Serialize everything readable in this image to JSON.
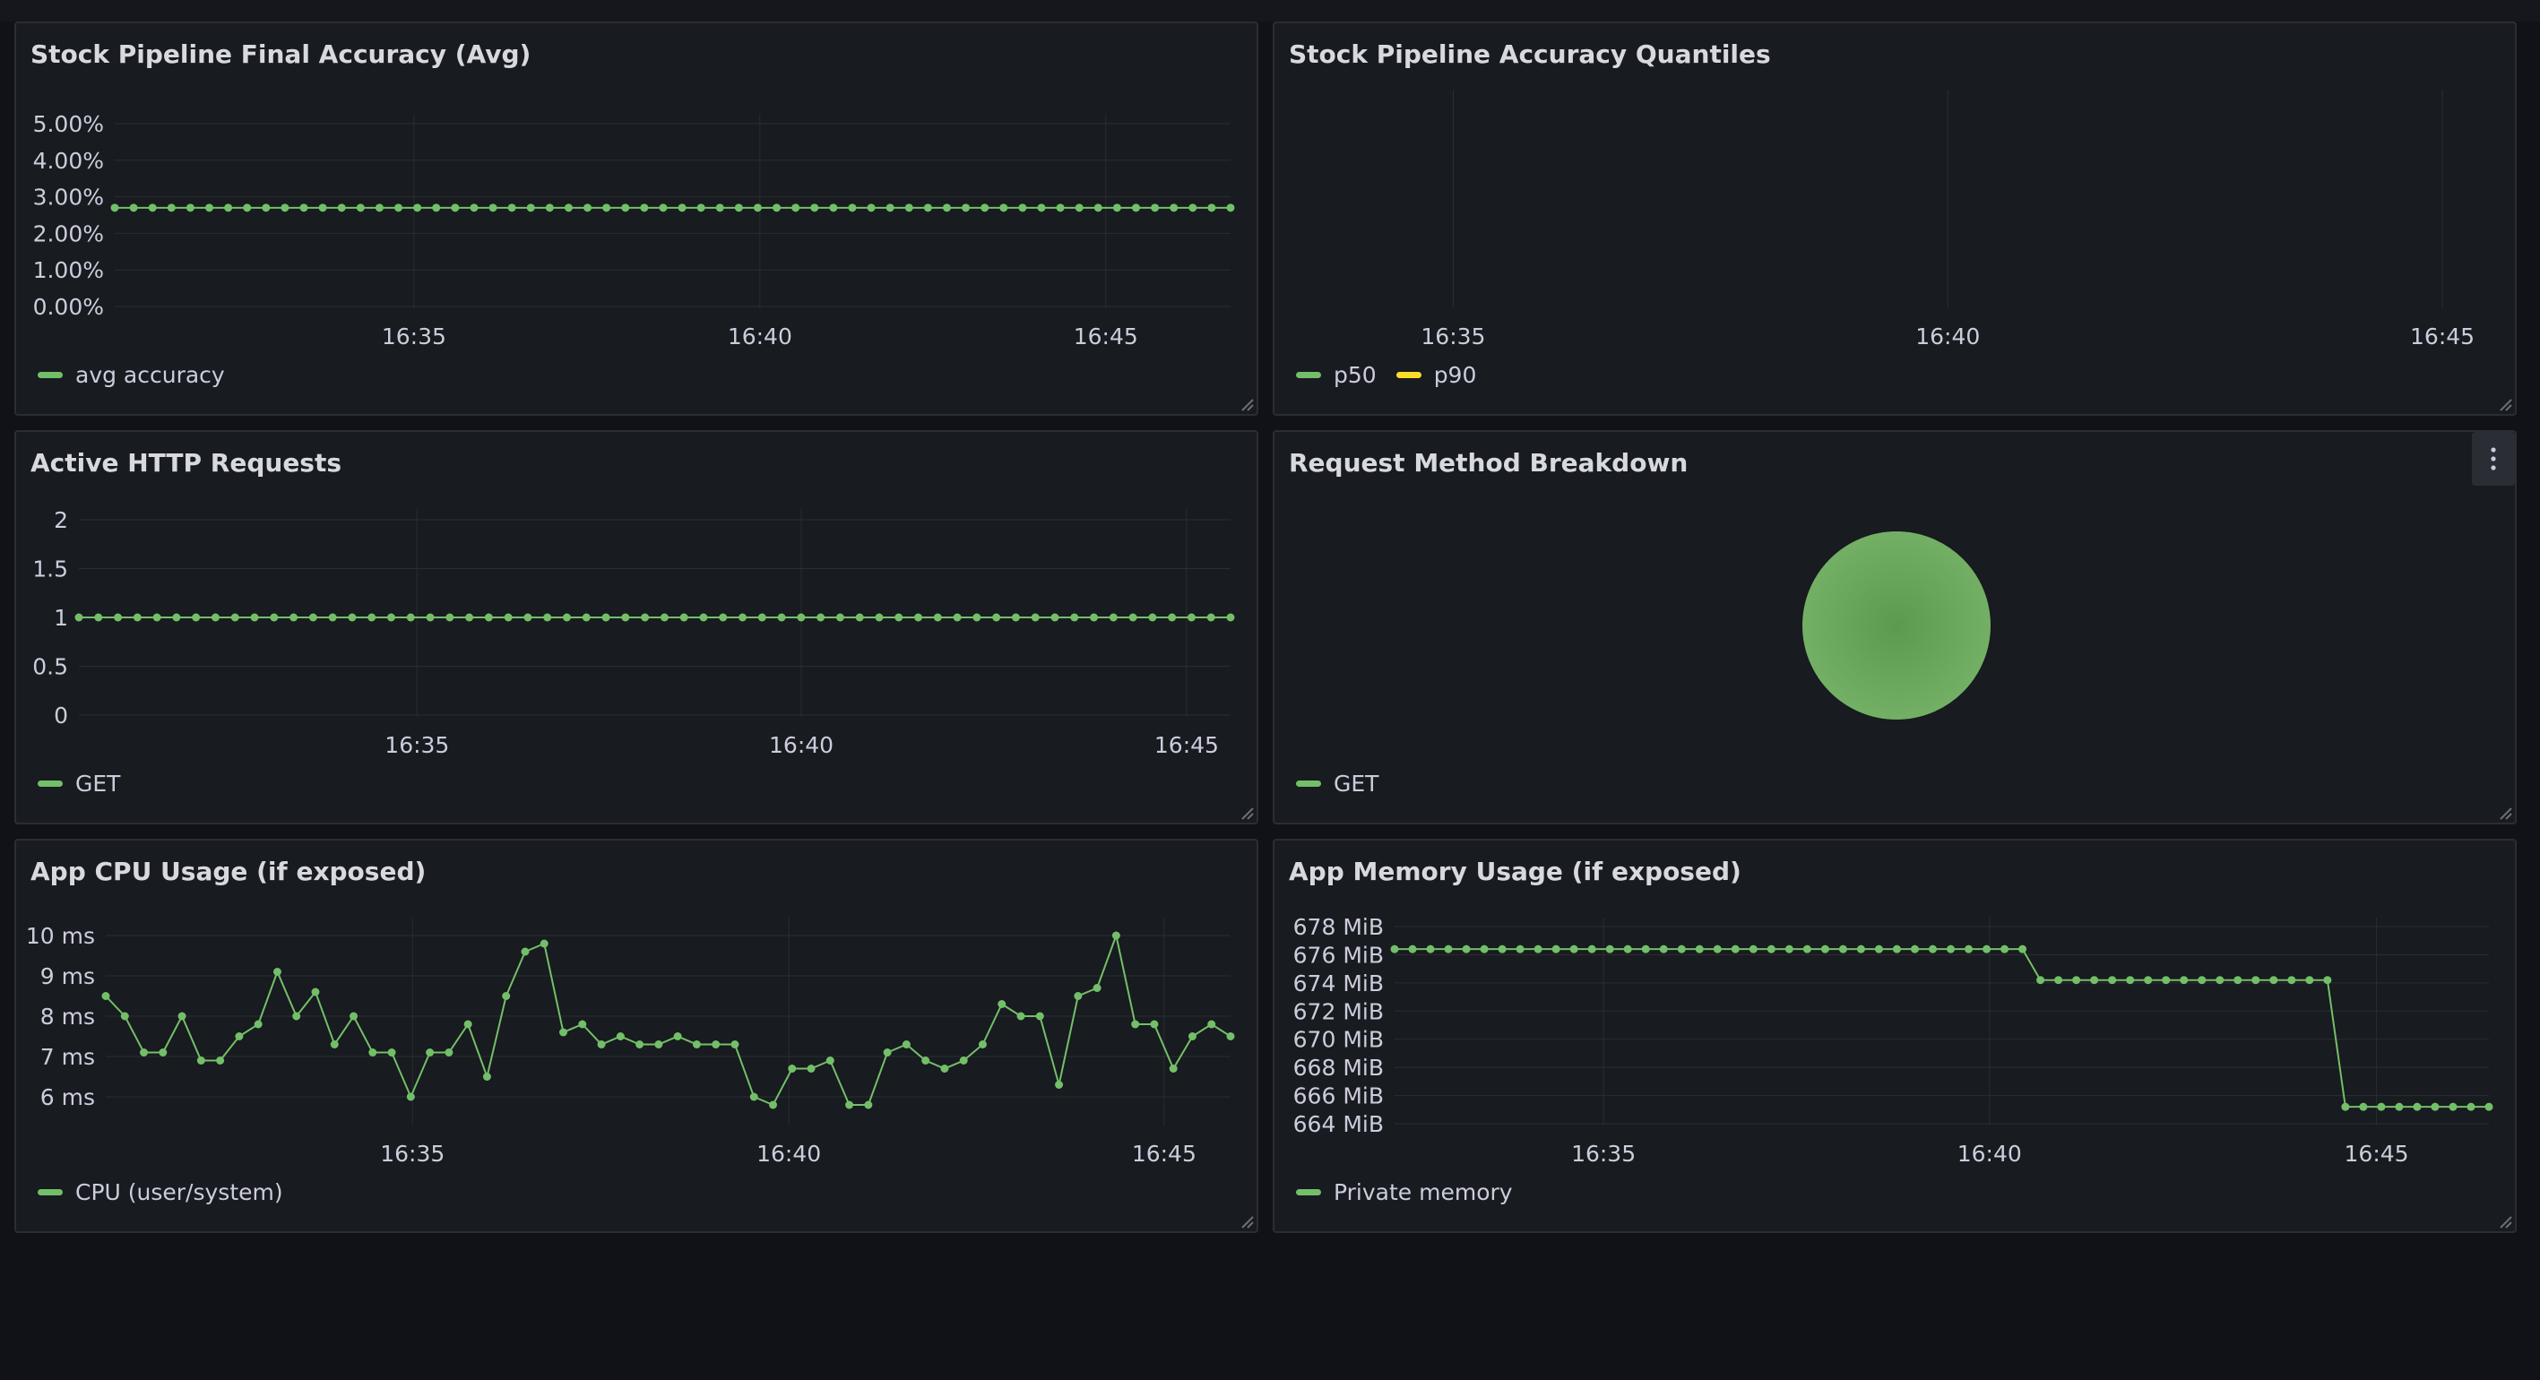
{
  "panels": [
    {
      "id": "accuracy-avg",
      "title": "Stock Pipeline Final Accuracy (Avg)",
      "legend": [
        {
          "label": "avg accuracy",
          "color": "#73bf69"
        }
      ]
    },
    {
      "id": "accuracy-quantiles",
      "title": "Stock Pipeline Accuracy Quantiles",
      "legend": [
        {
          "label": "p50",
          "color": "#73bf69"
        },
        {
          "label": "p90",
          "color": "#fade2a"
        }
      ]
    },
    {
      "id": "http-requests",
      "title": "Active HTTP Requests",
      "legend": [
        {
          "label": "GET",
          "color": "#73bf69"
        }
      ]
    },
    {
      "id": "method-breakdown",
      "title": "Request Method Breakdown",
      "legend": [
        {
          "label": "GET",
          "color": "#73bf69"
        }
      ],
      "menu_icon": "kebab-menu-icon"
    },
    {
      "id": "cpu-usage",
      "title": "App CPU Usage (if exposed)",
      "legend": [
        {
          "label": "CPU (user/system)",
          "color": "#73bf69"
        }
      ]
    },
    {
      "id": "memory-usage",
      "title": "App Memory Usage (if exposed)",
      "legend": [
        {
          "label": "Private memory",
          "color": "#73bf69"
        }
      ]
    }
  ],
  "chart_data": [
    {
      "panel": "accuracy-avg",
      "type": "line",
      "x_ticks": [
        "16:35",
        "16:40",
        "16:45"
      ],
      "y_ticks": [
        "5.00%",
        "4.00%",
        "3.00%",
        "2.00%",
        "1.00%",
        "0.00%"
      ],
      "ylim": [
        0,
        5
      ],
      "series": [
        {
          "name": "avg accuracy",
          "color": "#73bf69",
          "points": 60,
          "constant": 2.7
        }
      ]
    },
    {
      "panel": "accuracy-quantiles",
      "type": "line",
      "x_ticks": [
        "16:35",
        "16:40",
        "16:45"
      ],
      "series": [
        {
          "name": "p50",
          "color": "#73bf69",
          "values": []
        },
        {
          "name": "p90",
          "color": "#fade2a",
          "values": []
        }
      ]
    },
    {
      "panel": "http-requests",
      "type": "line",
      "x_ticks": [
        "16:35",
        "16:40",
        "16:45"
      ],
      "y_ticks": [
        "2",
        "1.5",
        "1",
        "0.5",
        "0"
      ],
      "ylim": [
        0,
        2
      ],
      "series": [
        {
          "name": "GET",
          "color": "#73bf69",
          "points": 60,
          "constant": 1
        }
      ]
    },
    {
      "panel": "method-breakdown",
      "type": "pie",
      "slices": [
        {
          "label": "GET",
          "value": 100,
          "color": "#73bf69"
        }
      ]
    },
    {
      "panel": "cpu-usage",
      "type": "line",
      "x_ticks": [
        "16:35",
        "16:40",
        "16:45"
      ],
      "y_ticks": [
        "10 ms",
        "9 ms",
        "8 ms",
        "7 ms",
        "6 ms"
      ],
      "ylim": [
        5.3,
        10.8
      ],
      "series": [
        {
          "name": "CPU (user/system)",
          "color": "#73bf69",
          "values": [
            8.5,
            8.0,
            7.1,
            7.1,
            8.0,
            6.9,
            6.9,
            7.5,
            7.8,
            9.1,
            8.0,
            8.6,
            7.3,
            8.0,
            7.1,
            7.1,
            6.0,
            7.1,
            7.1,
            7.8,
            6.5,
            8.5,
            9.6,
            9.8,
            7.6,
            7.8,
            7.3,
            7.5,
            7.3,
            7.3,
            7.5,
            7.3,
            7.3,
            7.3,
            6.0,
            5.8,
            6.7,
            6.7,
            6.9,
            5.8,
            5.8,
            7.1,
            7.3,
            6.9,
            6.7,
            6.9,
            7.3,
            8.3,
            8.0,
            8.0,
            6.3,
            8.5,
            8.7,
            10.0,
            7.8,
            7.8,
            6.7,
            7.5,
            7.8,
            7.5
          ]
        }
      ]
    },
    {
      "panel": "memory-usage",
      "type": "line",
      "x_ticks": [
        "16:35",
        "16:40",
        "16:45"
      ],
      "y_ticks": [
        "678 MiB",
        "676 MiB",
        "674 MiB",
        "672 MiB",
        "670 MiB",
        "668 MiB",
        "666 MiB",
        "664 MiB"
      ],
      "ylim": [
        664,
        678
      ],
      "series": [
        {
          "name": "Private memory",
          "color": "#73bf69",
          "values": [
            676.4,
            676.4,
            676.4,
            676.4,
            676.4,
            676.4,
            676.4,
            676.4,
            676.4,
            676.4,
            676.4,
            676.4,
            676.4,
            676.4,
            676.4,
            676.4,
            676.4,
            676.4,
            676.4,
            676.4,
            676.4,
            676.4,
            676.4,
            676.4,
            676.4,
            676.4,
            676.4,
            676.4,
            676.4,
            676.4,
            676.4,
            676.4,
            676.4,
            676.4,
            676.4,
            676.4,
            674.2,
            674.2,
            674.2,
            674.2,
            674.2,
            674.2,
            674.2,
            674.2,
            674.2,
            674.2,
            674.2,
            674.2,
            674.2,
            674.2,
            674.2,
            674.2,
            674.2,
            665.2,
            665.2,
            665.2,
            665.2,
            665.2,
            665.2,
            665.2,
            665.2,
            665.2
          ]
        }
      ]
    }
  ]
}
